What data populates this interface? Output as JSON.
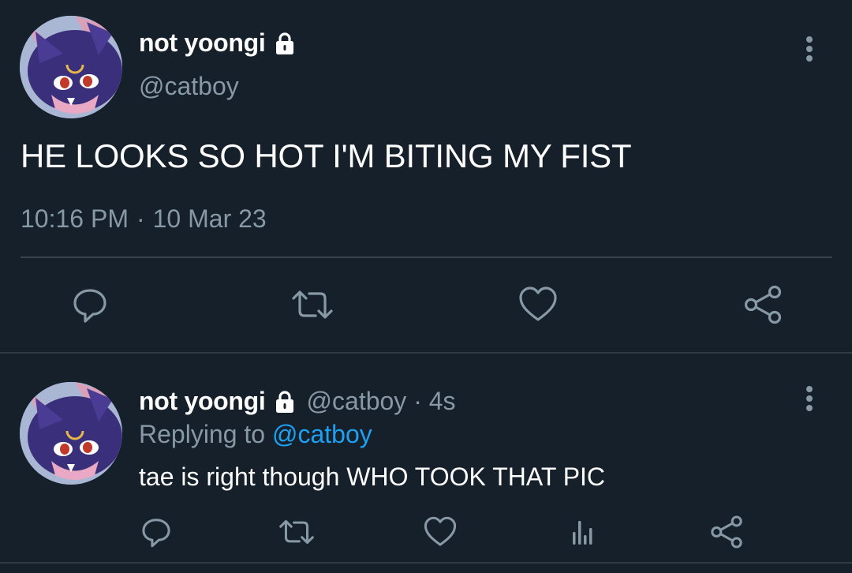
{
  "main_tweet": {
    "display_name": "not yoongi",
    "handle": "@catboy",
    "text": "HE LOOKS SO HOT I'M BITING MY FIST",
    "time": "10:16 PM",
    "separator": "·",
    "date": "10 Mar 23",
    "protected": true
  },
  "reply_tweet": {
    "display_name": "not yoongi",
    "handle_time": "@catboy · 4s",
    "replying_label": "Replying to",
    "replying_mention": "@catboy",
    "text": "tae is right though WHO TOOK THAT PIC",
    "protected": true
  },
  "icons": {
    "lock": "lock-icon",
    "more": "more-vertical-icon",
    "reply": "reply-icon",
    "retweet": "retweet-icon",
    "like": "like-heart-icon",
    "share": "share-icon",
    "analytics": "analytics-icon"
  },
  "colors": {
    "background": "#15202b",
    "primary_text": "#ffffff",
    "secondary_text": "#8899a6",
    "link": "#1da1f2",
    "divider": "#38444d"
  }
}
